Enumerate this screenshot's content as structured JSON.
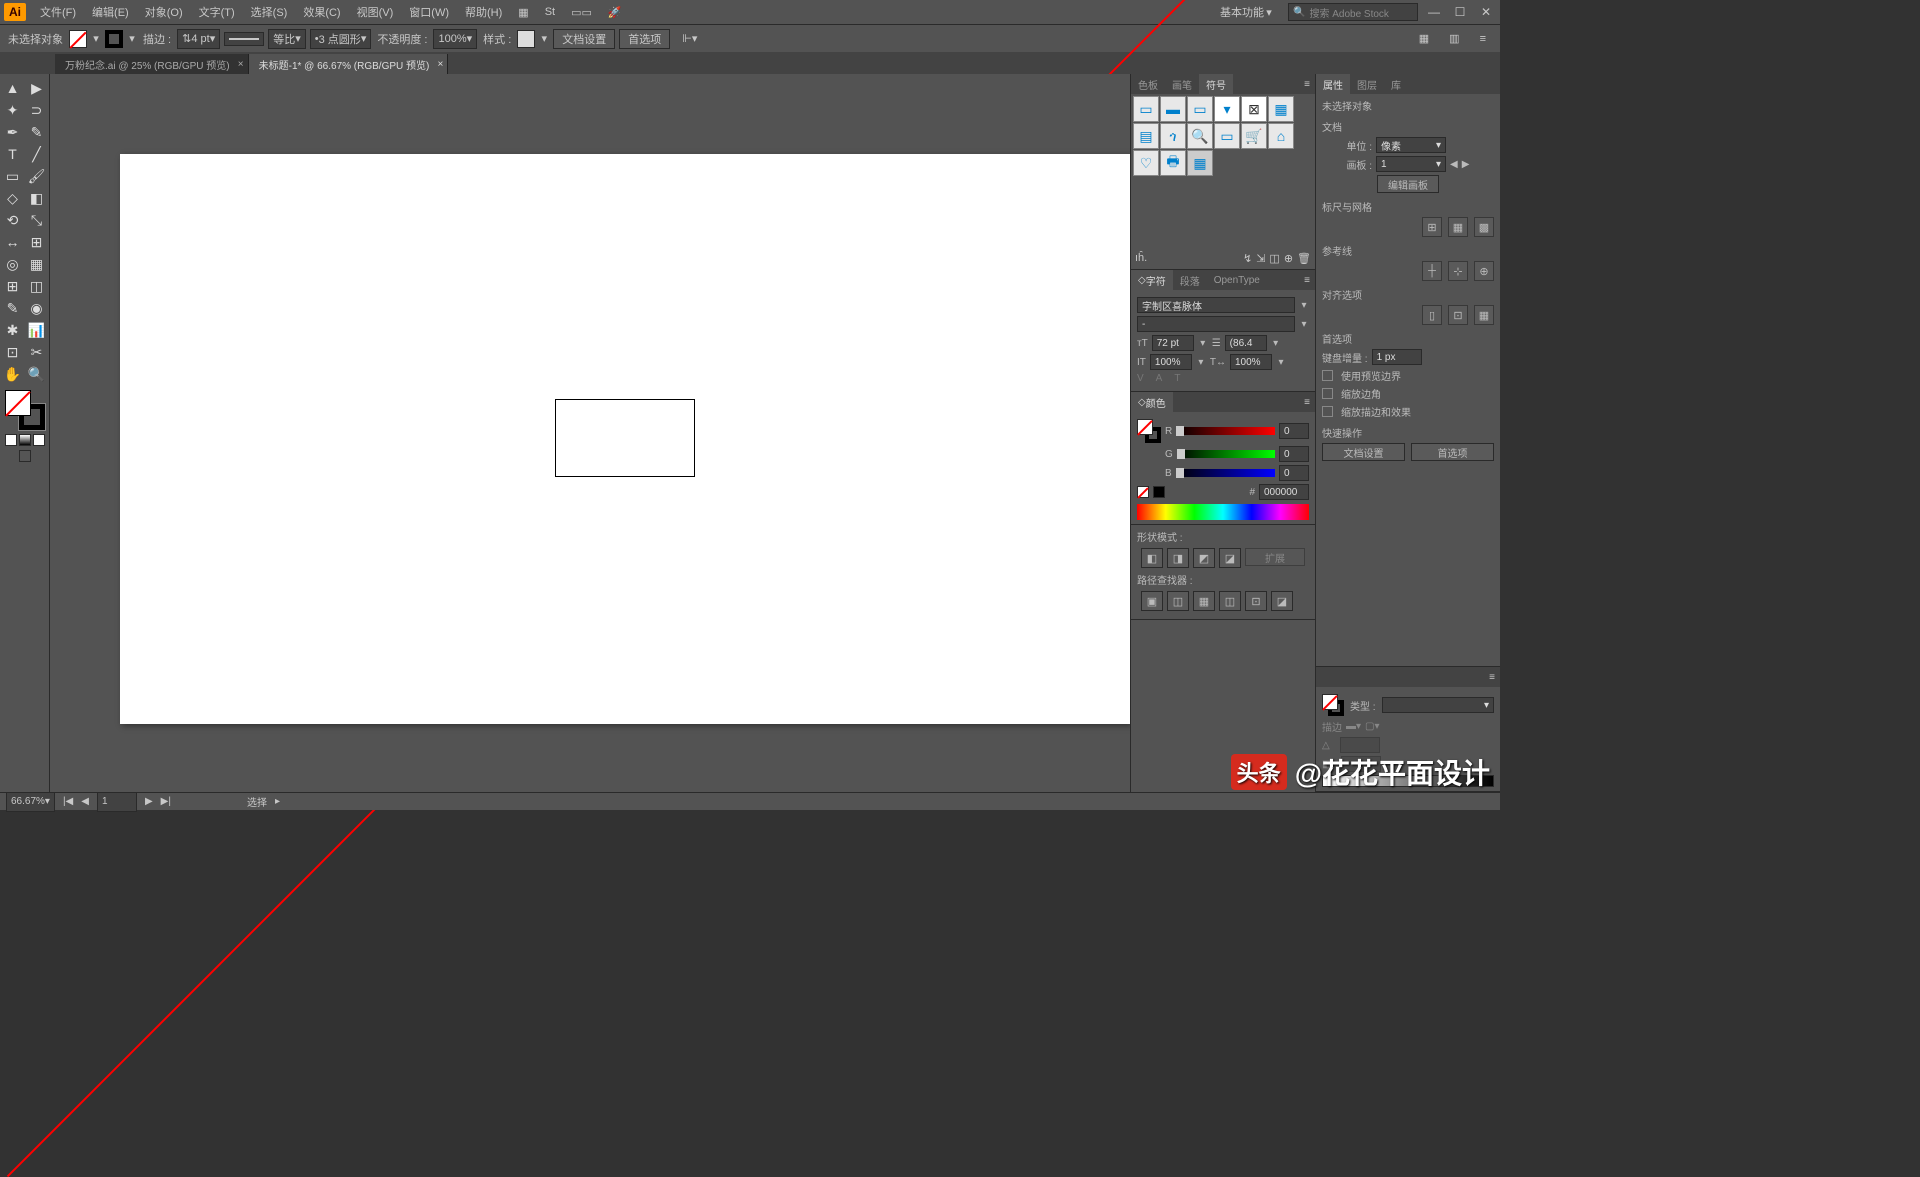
{
  "app": {
    "logo": "Ai"
  },
  "menu": {
    "items": [
      "文件(F)",
      "编辑(E)",
      "对象(O)",
      "文字(T)",
      "选择(S)",
      "效果(C)",
      "视图(V)",
      "窗口(W)",
      "帮助(H)"
    ],
    "workspace": "基本功能",
    "search_placeholder": "搜索 Adobe Stock"
  },
  "control": {
    "noselection": "未选择对象",
    "stroke_label": "描边 :",
    "stroke_weight": "4 pt",
    "uniform": "等比",
    "profile": "3 点圆形",
    "opacity_label": "不透明度 :",
    "opacity": "100%",
    "style_label": "样式 :",
    "docsetup": "文档设置",
    "prefs": "首选项"
  },
  "tabs": [
    {
      "label": "万粉纪念.ai @ 25% (RGB/GPU 预览)",
      "active": false
    },
    {
      "label": "未标题-1* @ 66.67% (RGB/GPU 预览)",
      "active": true
    }
  ],
  "panels": {
    "swatch_tabs": [
      "色板",
      "画笔",
      "符号"
    ],
    "char_tabs": [
      "字符",
      "段落",
      "OpenType"
    ],
    "font": "字制区喜脉体",
    "font_size": "72 pt",
    "leading": "(86.4",
    "hscale": "100%",
    "vscale": "100%",
    "color_tab": "颜色",
    "r": "R",
    "g": "G",
    "b": "B",
    "rval": "0",
    "gval": "0",
    "bval": "0",
    "hex": "000000",
    "shape_mode": "形状模式 :",
    "pathfinder": "路径查找器 :",
    "expand": "扩展"
  },
  "props": {
    "tabs": [
      "属性",
      "图层",
      "库"
    ],
    "nosel": "未选择对象",
    "doc_head": "文档",
    "unit_label": "单位 :",
    "unit": "像素",
    "artboard_label": "画板 :",
    "artboard": "1",
    "edit_artboard": "编辑画板",
    "ruler_grid": "标尺与网格",
    "guides": "参考线",
    "align_opts": "对齐选项",
    "prefs_head": "首选项",
    "key_inc_label": "键盘增量 :",
    "key_inc": "1 px",
    "cb1": "使用预览边界",
    "cb2": "缩放边角",
    "cb3": "缩放描边和效果",
    "quick_head": "快速操作",
    "docsetup": "文档设置",
    "prefs": "首选项",
    "appear_type_label": "类型 :",
    "appear_stroke": "描边"
  },
  "status": {
    "zoom": "66.67%",
    "artboard_nav": "1",
    "tool": "选择"
  },
  "watermark": {
    "logo": "头条",
    "text": "@花花平面设计"
  }
}
